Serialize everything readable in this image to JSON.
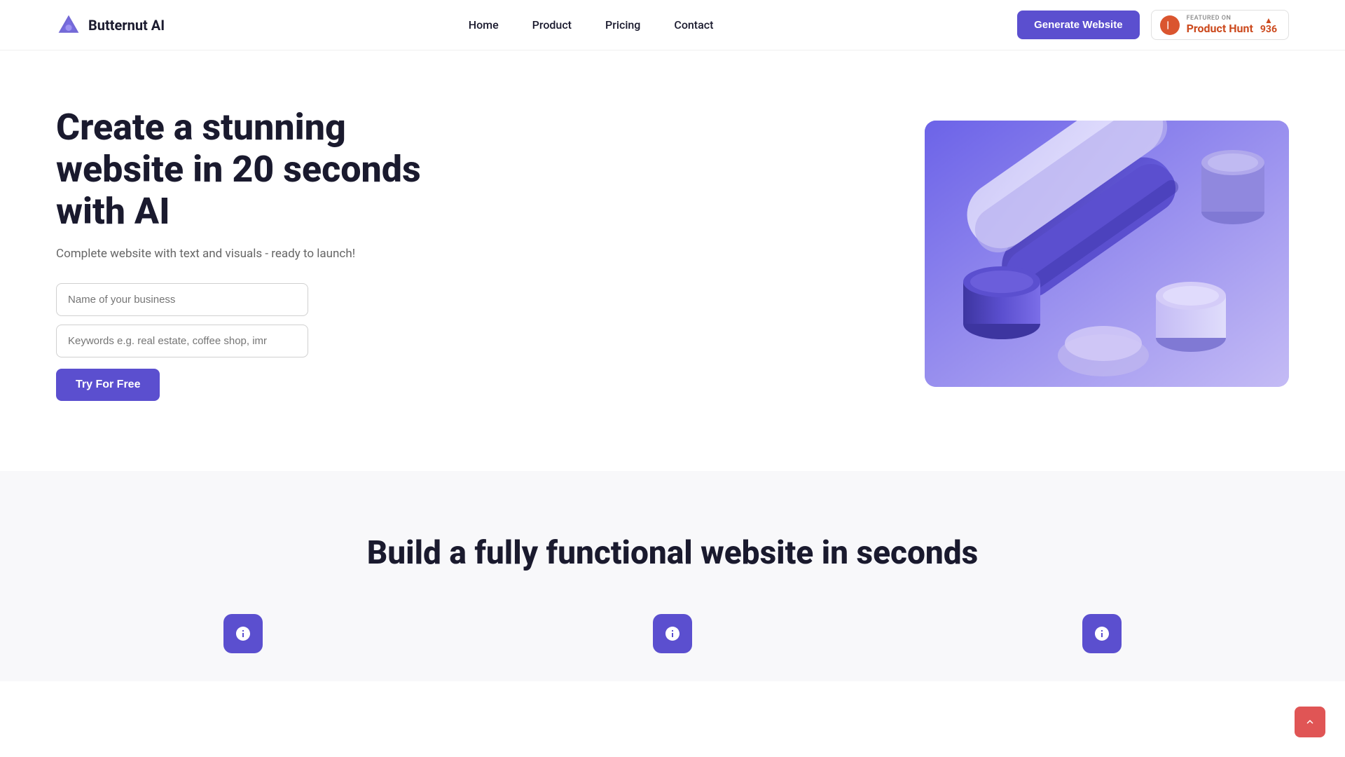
{
  "brand": {
    "logo_text": "Butternut AI"
  },
  "nav": {
    "links": [
      {
        "id": "home",
        "label": "Home"
      },
      {
        "id": "product",
        "label": "Product"
      },
      {
        "id": "pricing",
        "label": "Pricing"
      },
      {
        "id": "contact",
        "label": "Contact"
      }
    ],
    "cta_label": "Generate Website"
  },
  "product_hunt": {
    "featured_label": "FEATURED ON",
    "name": "Product Hunt",
    "count": "936"
  },
  "hero": {
    "headline": "Create a stunning website in 20 seconds with AI",
    "subtitle": "Complete website with text and visuals - ready to launch!",
    "input_business_placeholder": "Name of your business",
    "input_keywords_placeholder": "Keywords e.g. real estate, coffee shop, imr",
    "cta_label": "Try For Free"
  },
  "section2": {
    "headline": "Build a fully functional website in seconds"
  },
  "icons": {
    "scroll_top": "chevron-up"
  }
}
